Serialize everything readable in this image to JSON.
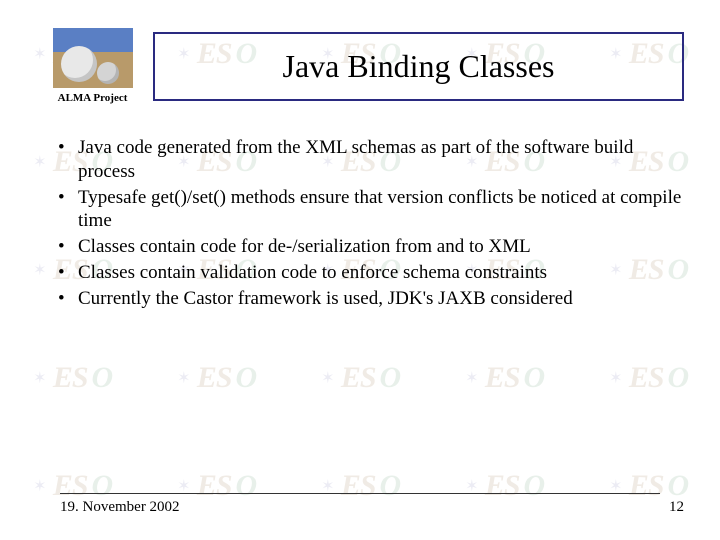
{
  "header": {
    "logo_caption": "ALMA Project",
    "title": "Java Binding Classes"
  },
  "bullets": [
    "Java code generated from the XML schemas as part of the software build process",
    "Typesafe get()/set() methods ensure that version conflicts be noticed at compile time",
    "Classes contain code for de-/serialization from and to XML",
    "Classes contain validation code to enforce schema constraints",
    "Currently the Castor framework is used, JDK's JAXB considered"
  ],
  "footer": {
    "date": "19. November 2002",
    "page": "12"
  },
  "watermark": {
    "es": "ES",
    "o": "O"
  }
}
